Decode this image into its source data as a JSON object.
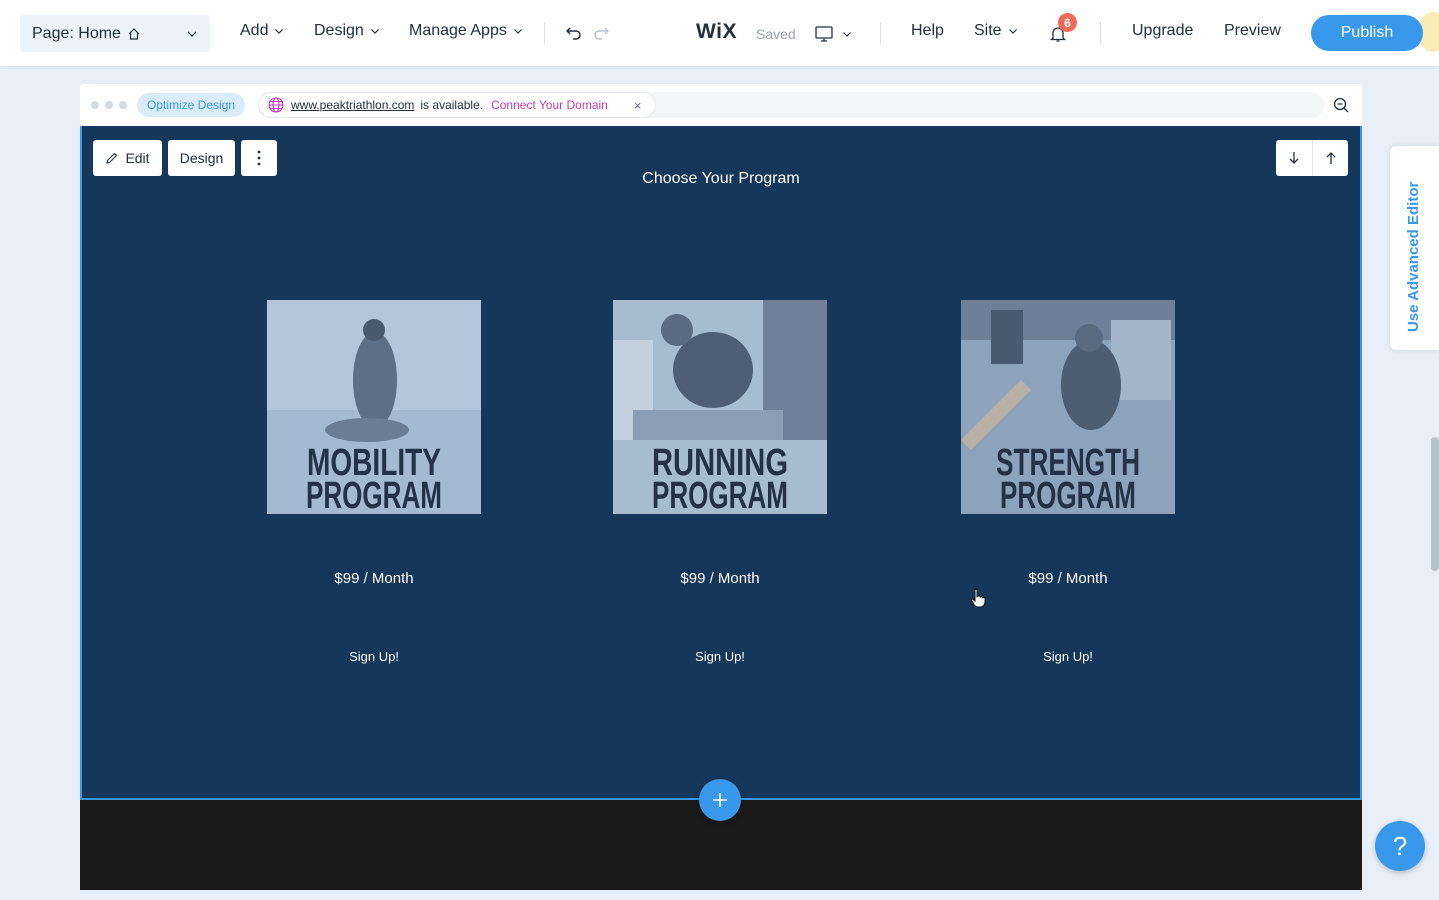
{
  "topbar": {
    "page_select": "Page: Home",
    "menus": [
      "Add",
      "Design",
      "Manage Apps"
    ],
    "logo": "WiX",
    "saved": "Saved",
    "help": "Help",
    "site": "Site",
    "notifications_count": "6",
    "upgrade": "Upgrade",
    "preview": "Preview",
    "publish": "Publish"
  },
  "frame": {
    "optimize": "Optimize Design",
    "domain_url": "www.peaktriathlon.com",
    "domain_available": "is available.",
    "connect": "Connect Your Domain",
    "close": "×"
  },
  "section": {
    "edit": "Edit",
    "design": "Design",
    "title": "Choose Your Program",
    "cards": [
      {
        "line1": "MOBILITY",
        "line2": "PROGRAM",
        "price": "$99 / Month",
        "cta": "Sign Up!"
      },
      {
        "line1": "RUNNING",
        "line2": "PROGRAM",
        "price": "$99 / Month",
        "cta": "Sign Up!"
      },
      {
        "line1": "STRENGTH",
        "line2": "PROGRAM",
        "price": "$99 / Month",
        "cta": "Sign Up!"
      }
    ]
  },
  "side": {
    "advanced_editor": "Use Advanced Editor",
    "help": "?"
  },
  "colors": {
    "accent": "#3899ec",
    "section_bg": "#14375a",
    "badge": "#f06a5b",
    "connect_link": "#c23ab7"
  }
}
